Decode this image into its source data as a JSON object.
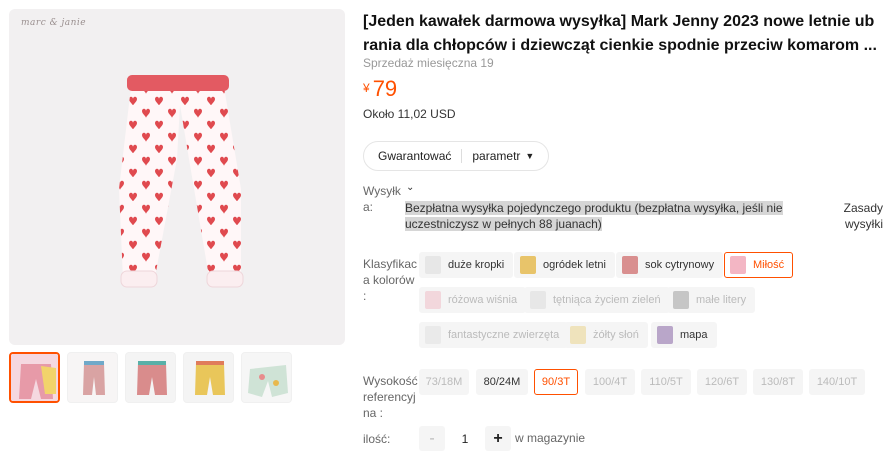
{
  "product": {
    "brand_watermark": "marc & janie",
    "title": "[Jeden kawałek darmowa wysyłka] Mark Jenny 2023 nowe letnie ub rania dla chłopców i dziewcząt cienkie spodnie przeciw komarom ...",
    "monthly_sales": "Sprzedaż miesięczna 19",
    "currency_symbol": "¥",
    "price": "79",
    "approx_price": "Około 11,02 USD"
  },
  "tabs": {
    "guarantee": "Gwarantować",
    "params": "parametr"
  },
  "shipping": {
    "label_line1": "Wysyłk",
    "label_line2": "a:",
    "text": "Bezpłatna wysyłka pojedynczego produktu (bezpłatna wysyłka, jeśli nie uczestniczysz w pełnych 88 juanach)",
    "rules_label": "Zasady wysyłki"
  },
  "color": {
    "label": "Klasyfikacja kolorów :",
    "label_l1": "Klasyfikac",
    "label_l2": "ja",
    "label_l3": "a kolorów",
    "label_l4": ":",
    "options": [
      {
        "label": "duże kropki",
        "state": "normal",
        "swatch": "#dcdcdc"
      },
      {
        "label": "ogródek letni",
        "state": "normal",
        "swatch": "#e8c46a"
      },
      {
        "label": "sok cytrynowy",
        "state": "normal",
        "swatch": "#d98f8f"
      },
      {
        "label": "Miłość",
        "state": "selected",
        "swatch": "#f3b6c4"
      },
      {
        "label": "różowa wiśnia",
        "state": "disabled",
        "swatch": "#efb3bf"
      },
      {
        "label": "tętniąca życiem zieleń",
        "state": "disabled",
        "swatch": "#d8d8d8"
      },
      {
        "label": "małe litery",
        "state": "disabled",
        "swatch": "#8d8d8d"
      },
      {
        "label": "fantastyczne zwierzęta",
        "state": "disabled",
        "swatch": "#dddddd"
      },
      {
        "label": "żółty słoń",
        "state": "disabled",
        "swatch": "#e8cf78"
      },
      {
        "label": "mapa",
        "state": "normal",
        "swatch": "#b9a6c9"
      }
    ]
  },
  "size": {
    "label_l1": "Wysokość",
    "label_l2": "referencyj",
    "label_l3": "na :",
    "options": [
      {
        "label": "73/18M",
        "state": "disabled"
      },
      {
        "label": "80/24M",
        "state": "normal"
      },
      {
        "label": "90/3T",
        "state": "selected"
      },
      {
        "label": "100/4T",
        "state": "disabled"
      },
      {
        "label": "110/5T",
        "state": "disabled"
      },
      {
        "label": "120/6T",
        "state": "disabled"
      },
      {
        "label": "130/8T",
        "state": "disabled"
      },
      {
        "label": "140/10T",
        "state": "disabled"
      }
    ]
  },
  "quantity": {
    "label": "ilość:",
    "minus": "-",
    "value": "1",
    "plus": "+",
    "stock": "w magazynie"
  },
  "colors": {
    "accent": "#ff5000"
  }
}
